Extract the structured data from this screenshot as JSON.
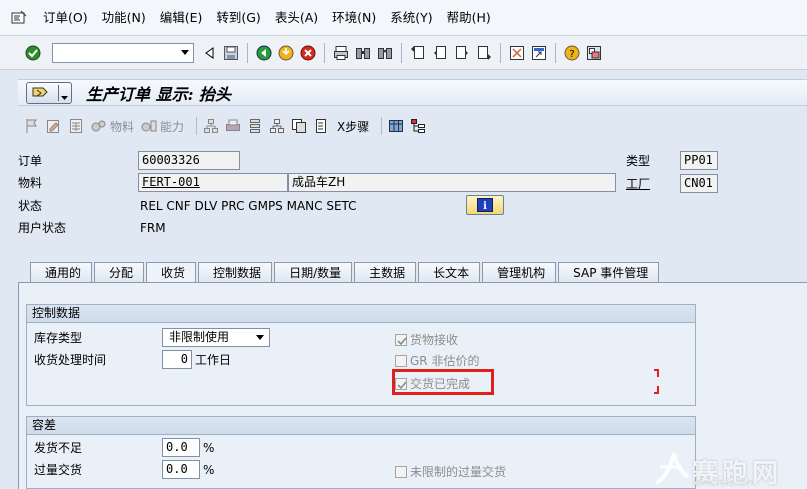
{
  "menu": [
    "订单(O)",
    "功能(N)",
    "编辑(E)",
    "转到(G)",
    "表头(A)",
    "环境(N)",
    "系统(Y)",
    "帮助(H)"
  ],
  "title": "生产订单 显示: 抬头",
  "app_toolbar": {
    "material_label": "物料",
    "capacity_label": "能力",
    "x_steps_label": "X步骤"
  },
  "header": {
    "order_label": "订单",
    "order_value": "60003326",
    "material_label": "物料",
    "material_value": "FERT-001",
    "material_desc": "成品车ZH",
    "status_label": "状态",
    "status_value": "REL  CNF  DLV  PRC  GMPS MANC SETC",
    "user_status_label": "用户状态",
    "user_status_value": "FRM",
    "type_label": "类型",
    "type_value": "PP01",
    "plant_label": "工厂",
    "plant_value": "CN01"
  },
  "tabs": [
    "通用的",
    "分配",
    "收货",
    "控制数据",
    "日期/数量",
    "主数据",
    "长文本",
    "管理机构",
    "SAP 事件管理"
  ],
  "active_tab": "收货",
  "control_group": {
    "title": "控制数据",
    "stock_type_label": "库存类型",
    "stock_type_value": "非限制使用",
    "gr_time_label": "收货处理时间",
    "gr_time_value": "0",
    "gr_time_unit": "工作日",
    "cb_goods_receipt": "货物接收",
    "cb_gr_non_valuated": "GR 非估价的",
    "cb_delivery_completed": "交货已完成"
  },
  "tolerance_group": {
    "title": "容差",
    "under_label": "发货不足",
    "under_value": "0.0",
    "under_unit": "%",
    "over_label": "过量交货",
    "over_value": "0.0",
    "over_unit": "%",
    "cb_unlimited_over": "未限制的过量交货"
  },
  "watermark": {
    "text": "赛跑网",
    "url": "www.3s5p.com"
  }
}
